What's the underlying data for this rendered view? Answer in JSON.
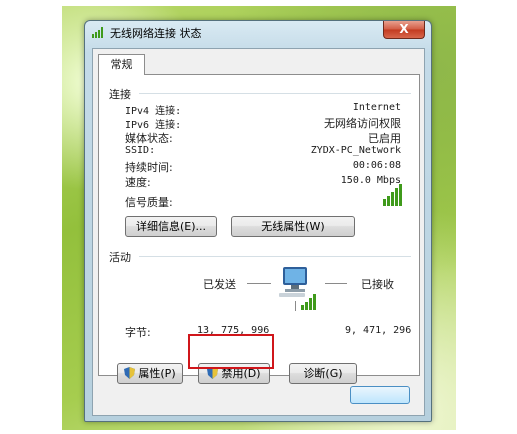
{
  "window": {
    "title": "无线网络连接 状态",
    "close_glyph": "X"
  },
  "tabs": [
    {
      "label": "常规"
    }
  ],
  "connection": {
    "heading": "连接",
    "rows": [
      {
        "label": "IPv4 连接:",
        "value": "Internet"
      },
      {
        "label": "IPv6 连接:",
        "value": "无网络访问权限"
      },
      {
        "label": "媒体状态:",
        "value": "已启用"
      },
      {
        "label": "SSID:",
        "value": "ZYDX-PC_Network"
      },
      {
        "label": "持续时间:",
        "value": "00:06:08"
      },
      {
        "label": "速度:",
        "value": "150.0 Mbps"
      }
    ],
    "signal_label": "信号质量:",
    "signal_icon": "signal-bars-icon",
    "details_button": "详细信息(E)...",
    "wireless_props_button": "无线属性(W)"
  },
  "activity": {
    "heading": "活动",
    "sent_label": "已发送",
    "received_label": "已接收",
    "bytes_label": "字节:",
    "bytes_sent": "13, 775, 996",
    "bytes_received": "9, 471, 296",
    "network_icon": "network-computer-icon"
  },
  "buttons": {
    "properties": "属性(P)",
    "disable": "禁用(D)",
    "diagnose": "诊断(G)"
  },
  "colors": {
    "highlight_box": "#d0161b",
    "signal_green": "#3f9a1b"
  }
}
